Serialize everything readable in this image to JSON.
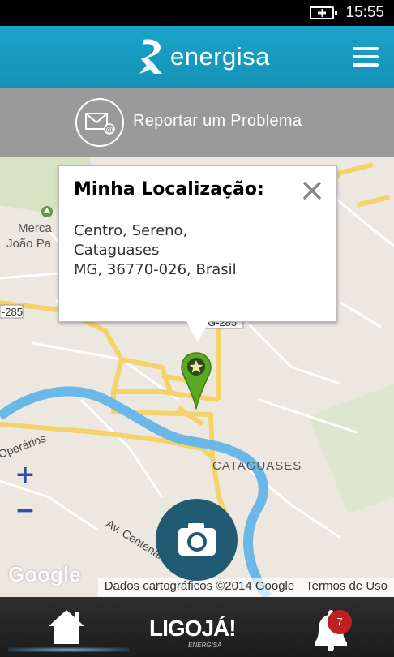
{
  "status_bar": {
    "time": "15:55",
    "battery_icon": "battery-charging-icon"
  },
  "header": {
    "logo_text": "energisa",
    "menu_icon": "hamburger-menu-icon"
  },
  "report": {
    "icon": "mail-at-icon",
    "label": "Reportar um Problema"
  },
  "map": {
    "popup": {
      "title": "Minha Localização:",
      "address_lines": [
        "Centro, Sereno,",
        "Cataguases",
        "MG, 36770-026, Brasil"
      ],
      "close_icon": "close-icon"
    },
    "labels": {
      "mercado": "Merca",
      "joao": "João Pa",
      "cataguases": "CATAGUASES",
      "operarios": "Operários",
      "centenario": "Av. Centenario",
      "road_285_left": "-285",
      "road_285_right": "G-285"
    },
    "zoom_in": "+",
    "zoom_out": "−",
    "google_logo": "Google",
    "attribution": {
      "data": "Dados cartográficos ©2014 Google",
      "terms": "Termos de Uso"
    },
    "pin_icon": "location-pin-star-icon",
    "camera_icon": "camera-icon"
  },
  "bottom_nav": {
    "home_icon": "home-icon",
    "ligoja_text": "LIGOJÁ!",
    "ligoja_sub": "ENERGISA",
    "bell_icon": "bell-icon",
    "badge_count": "7"
  },
  "colors": {
    "header": "#1ba3c9",
    "report_bar": "#9a9a9a",
    "camera": "#205b73",
    "pin": "#5aa823",
    "badge": "#c01f1f"
  }
}
